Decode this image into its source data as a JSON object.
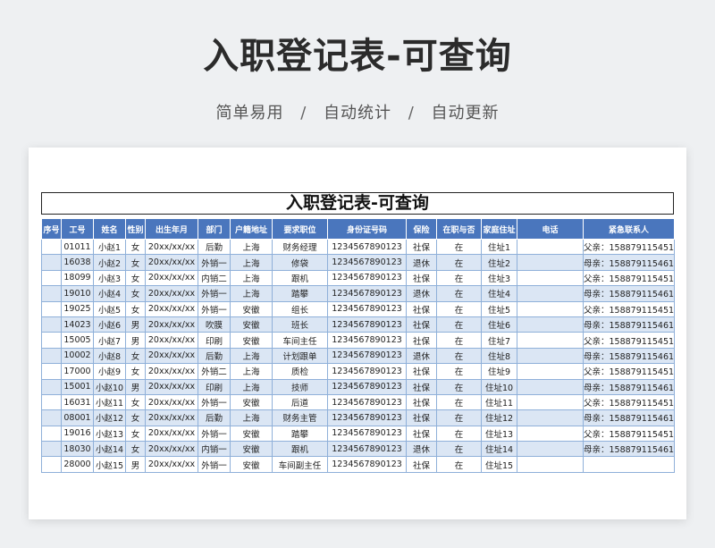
{
  "hero_title": "入职登记表-可查询",
  "subtitle": {
    "items": [
      "简单易用",
      "自动统计",
      "自动更新"
    ],
    "separator": "/"
  },
  "sheet_title": "入职登记表-可查询",
  "columns": [
    "序号",
    "工号",
    "姓名",
    "性别",
    "出生年月",
    "部门",
    "户籍地址",
    "要求职位",
    "身份证号码",
    "保险",
    "在职与否",
    "家庭住址",
    "电话",
    "紧急联系人"
  ],
  "rows": [
    [
      "",
      "01011",
      "小赵1",
      "女",
      "20xx/xx/xx",
      "后勤",
      "上海",
      "财务经理",
      "1234567890123",
      "社保",
      "在",
      "住址1",
      "",
      "父亲：15887911545​1"
    ],
    [
      "",
      "16038",
      "小赵2",
      "女",
      "20xx/xx/xx",
      "外销一",
      "上海",
      "修袋",
      "1234567890123",
      "退休",
      "在",
      "住址2",
      "",
      "母亲：158879115461"
    ],
    [
      "",
      "18099",
      "小赵3",
      "女",
      "20xx/xx/xx",
      "内销二",
      "上海",
      "跟机",
      "1234567890123",
      "社保",
      "在",
      "住址3",
      "",
      "父亲：158879115451"
    ],
    [
      "",
      "19010",
      "小赵4",
      "女",
      "20xx/xx/xx",
      "外销一",
      "上海",
      "踏攀",
      "1234567890123",
      "退休",
      "在",
      "住址4",
      "",
      "母亲：158879115461"
    ],
    [
      "",
      "19025",
      "小赵5",
      "女",
      "20xx/xx/xx",
      "外销一",
      "安徽",
      "组长",
      "1234567890123",
      "社保",
      "在",
      "住址5",
      "",
      "父亲：158879115451"
    ],
    [
      "",
      "14023",
      "小赵6",
      "男",
      "20xx/xx/xx",
      "吹膜",
      "安徽",
      "班长",
      "1234567890123",
      "社保",
      "在",
      "住址6",
      "",
      "母亲：158879115461"
    ],
    [
      "",
      "15005",
      "小赵7",
      "男",
      "20xx/xx/xx",
      "印刷",
      "安徽",
      "车间主任",
      "1234567890123",
      "社保",
      "在",
      "住址7",
      "",
      "父亲：158879115451"
    ],
    [
      "",
      "10002",
      "小赵8",
      "女",
      "20xx/xx/xx",
      "后勤",
      "上海",
      "计划跟单",
      "1234567890123",
      "退休",
      "在",
      "住址8",
      "",
      "母亲：158879115461"
    ],
    [
      "",
      "17000",
      "小赵9",
      "女",
      "20xx/xx/xx",
      "外销二",
      "上海",
      "质检",
      "1234567890123",
      "社保",
      "在",
      "住址9",
      "",
      "父亲：158879115451"
    ],
    [
      "",
      "15001",
      "小赵10",
      "男",
      "20xx/xx/xx",
      "印刷",
      "上海",
      "技师",
      "1234567890123",
      "社保",
      "在",
      "住址10",
      "",
      "母亲：158879115461"
    ],
    [
      "",
      "16031",
      "小赵11",
      "女",
      "20xx/xx/xx",
      "外销一",
      "安徽",
      "后道",
      "1234567890123",
      "社保",
      "在",
      "住址11",
      "",
      "父亲：158879115451"
    ],
    [
      "",
      "08001",
      "小赵12",
      "女",
      "20xx/xx/xx",
      "后勤",
      "上海",
      "财务主管",
      "1234567890123",
      "社保",
      "在",
      "住址12",
      "",
      "母亲：158879115461"
    ],
    [
      "",
      "19016",
      "小赵13",
      "女",
      "20xx/xx/xx",
      "外销一",
      "安徽",
      "踏攀",
      "1234567890123",
      "社保",
      "在",
      "住址13",
      "",
      "父亲：158879115451"
    ],
    [
      "",
      "18030",
      "小赵14",
      "女",
      "20xx/xx/xx",
      "内销一",
      "安徽",
      "跟机",
      "1234567890123",
      "退休",
      "在",
      "住址14",
      "",
      "母亲：158879115461"
    ],
    [
      "",
      "28000",
      "小赵15",
      "男",
      "20xx/xx/xx",
      "外销一",
      "安徽",
      "车间副主任",
      "1234567890123",
      "社保",
      "在",
      "住址15",
      "",
      ""
    ]
  ]
}
